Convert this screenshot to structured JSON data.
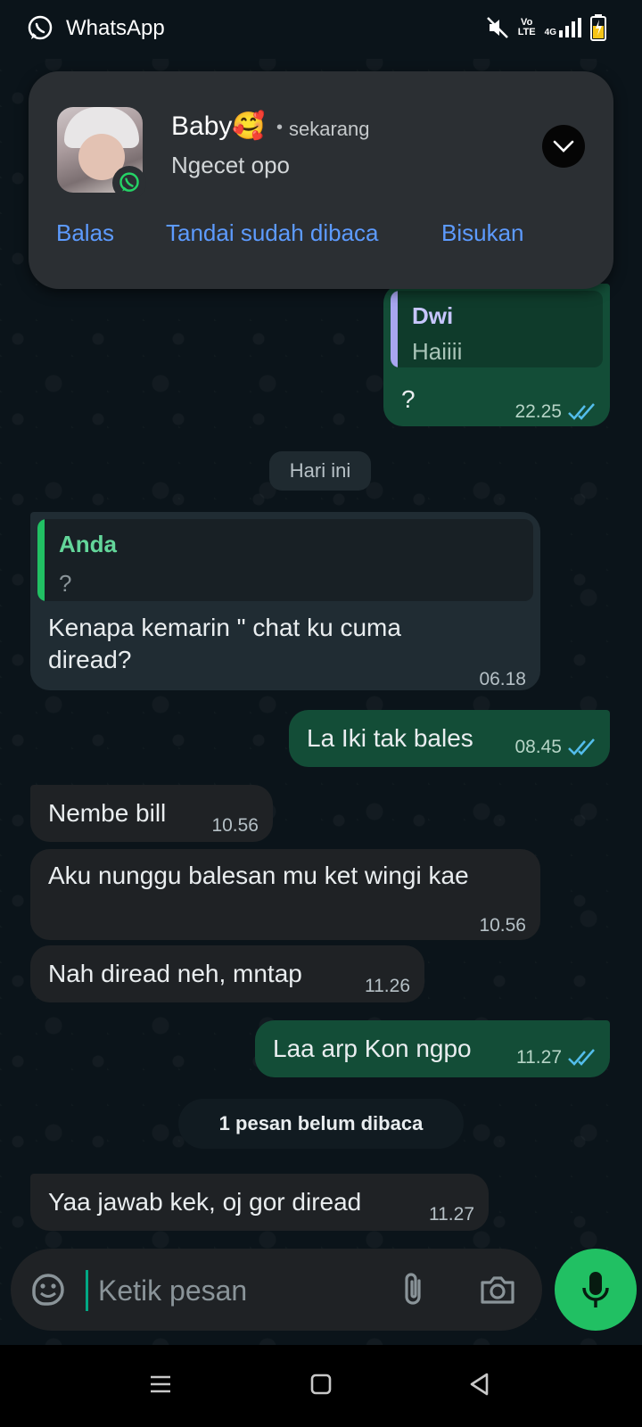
{
  "status_bar": {
    "app_name": "WhatsApp",
    "net_top": "Vo",
    "net_bottom": "LTE",
    "net_gen": "4G"
  },
  "notification": {
    "sender": "Baby🥰",
    "time": "sekarang",
    "message": "Ngecet opo",
    "actions": [
      "Balas",
      "Tandai sudah dibaca",
      "Bisukan"
    ]
  },
  "messages": [
    {
      "dir": "out",
      "quote_name": "Dwi",
      "quote_text": "Haiiii",
      "text": "?",
      "time": "22.25",
      "read": true
    },
    {
      "type": "date",
      "label": "Hari ini"
    },
    {
      "dir": "in",
      "quote_name": "Anda",
      "quote_text": "?",
      "text": "Kenapa kemarin \" chat ku cuma diread?",
      "time": "06.18"
    },
    {
      "dir": "out",
      "text": "La Iki tak bales",
      "time": "08.45",
      "read": true
    },
    {
      "dir": "in",
      "text": "Nembe bill",
      "time": "10.56"
    },
    {
      "dir": "in",
      "text": "Aku nunggu balesan mu ket wingi kae",
      "time": "10.56"
    },
    {
      "dir": "in",
      "text": "Nah diread neh, mntap",
      "time": "11.26"
    },
    {
      "dir": "out",
      "text": "Laa arp Kon ngpo",
      "time": "11.27",
      "read": true
    },
    {
      "type": "unread",
      "label": "1 pesan belum dibaca"
    },
    {
      "dir": "in",
      "text": "Yaa jawab kek, oj gor diread",
      "time": "11.27"
    }
  ],
  "composer": {
    "placeholder": "Ketik pesan"
  },
  "colors": {
    "accent": "#21c063",
    "link": "#5d9bff",
    "read_ticks": "#53bdeb"
  }
}
